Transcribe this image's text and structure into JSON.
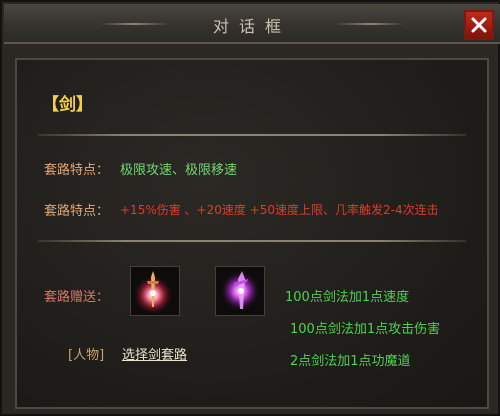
{
  "window": {
    "title": "对话框"
  },
  "colors": {
    "heading": "#f2cf48",
    "green_text": "#73d673",
    "red_text": "#e03a2c",
    "label": "#e0a878",
    "close_red": "#c2281b"
  },
  "icons": {
    "close": "close-x-icon",
    "item1": "sword-weapon-icon",
    "item2": "magic-blade-icon"
  },
  "content": {
    "heading": "【剑】",
    "feature1_label": "套路特点：",
    "feature1_value": "极限攻速、极限移速",
    "feature2_label": "套路特点：",
    "feature2_value": "+15%伤害 、+20速度 +50速度上限、几率触发2-4次连击",
    "gift_label": "套路赠送：",
    "rewards": [
      "100点剑法加1点速度",
      "100点剑法加1点攻击伤害",
      "2点剑法加1点功魔道"
    ],
    "role_tag": "[人物]",
    "select_link": "选择剑套路"
  }
}
